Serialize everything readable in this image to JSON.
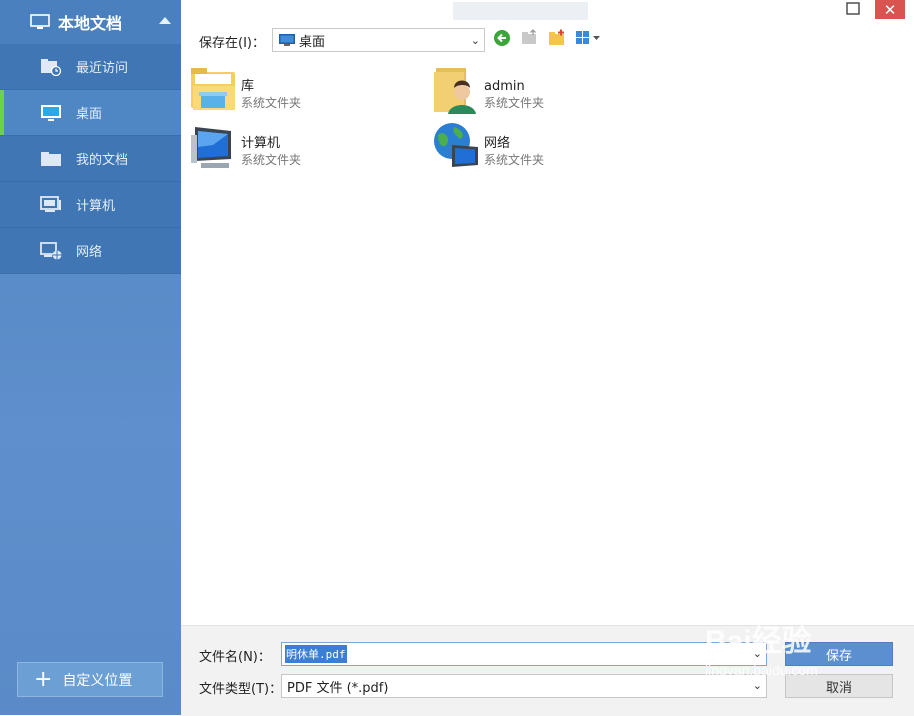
{
  "sidebar": {
    "header_title": "本地文档",
    "items": [
      {
        "label": "最近访问",
        "icon": "recent-folder-icon"
      },
      {
        "label": "桌面",
        "icon": "desktop-icon"
      },
      {
        "label": "我的文档",
        "icon": "folder-icon"
      },
      {
        "label": "计算机",
        "icon": "computer-icon"
      },
      {
        "label": "网络",
        "icon": "network-icon"
      }
    ],
    "active_index": 1,
    "custom_button_label": "自定义位置"
  },
  "toolbar": {
    "save_in_label": "保存在(I)：",
    "location_value": "桌面"
  },
  "files": [
    {
      "name": "库",
      "desc": "系统文件夹",
      "icon": "library-icon"
    },
    {
      "name": "admin",
      "desc": "系统文件夹",
      "icon": "user-folder-icon"
    },
    {
      "name": "计算机",
      "desc": "系统文件夹",
      "icon": "computer-icon"
    },
    {
      "name": "网络",
      "desc": "系统文件夹",
      "icon": "network-globe-icon"
    }
  ],
  "footer": {
    "filename_label": "文件名(N)：",
    "filename_value": "明休单.pdf",
    "filetype_label": "文件类型(T)：",
    "filetype_value": "PDF 文件 (*.pdf)",
    "save_button": "保存",
    "cancel_button": "取消"
  },
  "watermark": {
    "text": "Bai经验",
    "sub": "jingyan.baidu.com"
  },
  "colors": {
    "sidebar_bg": "#4d85c0",
    "active_accent": "#6cd24a",
    "close_button": "#d9534f",
    "primary_button": "#5b8fcf"
  }
}
